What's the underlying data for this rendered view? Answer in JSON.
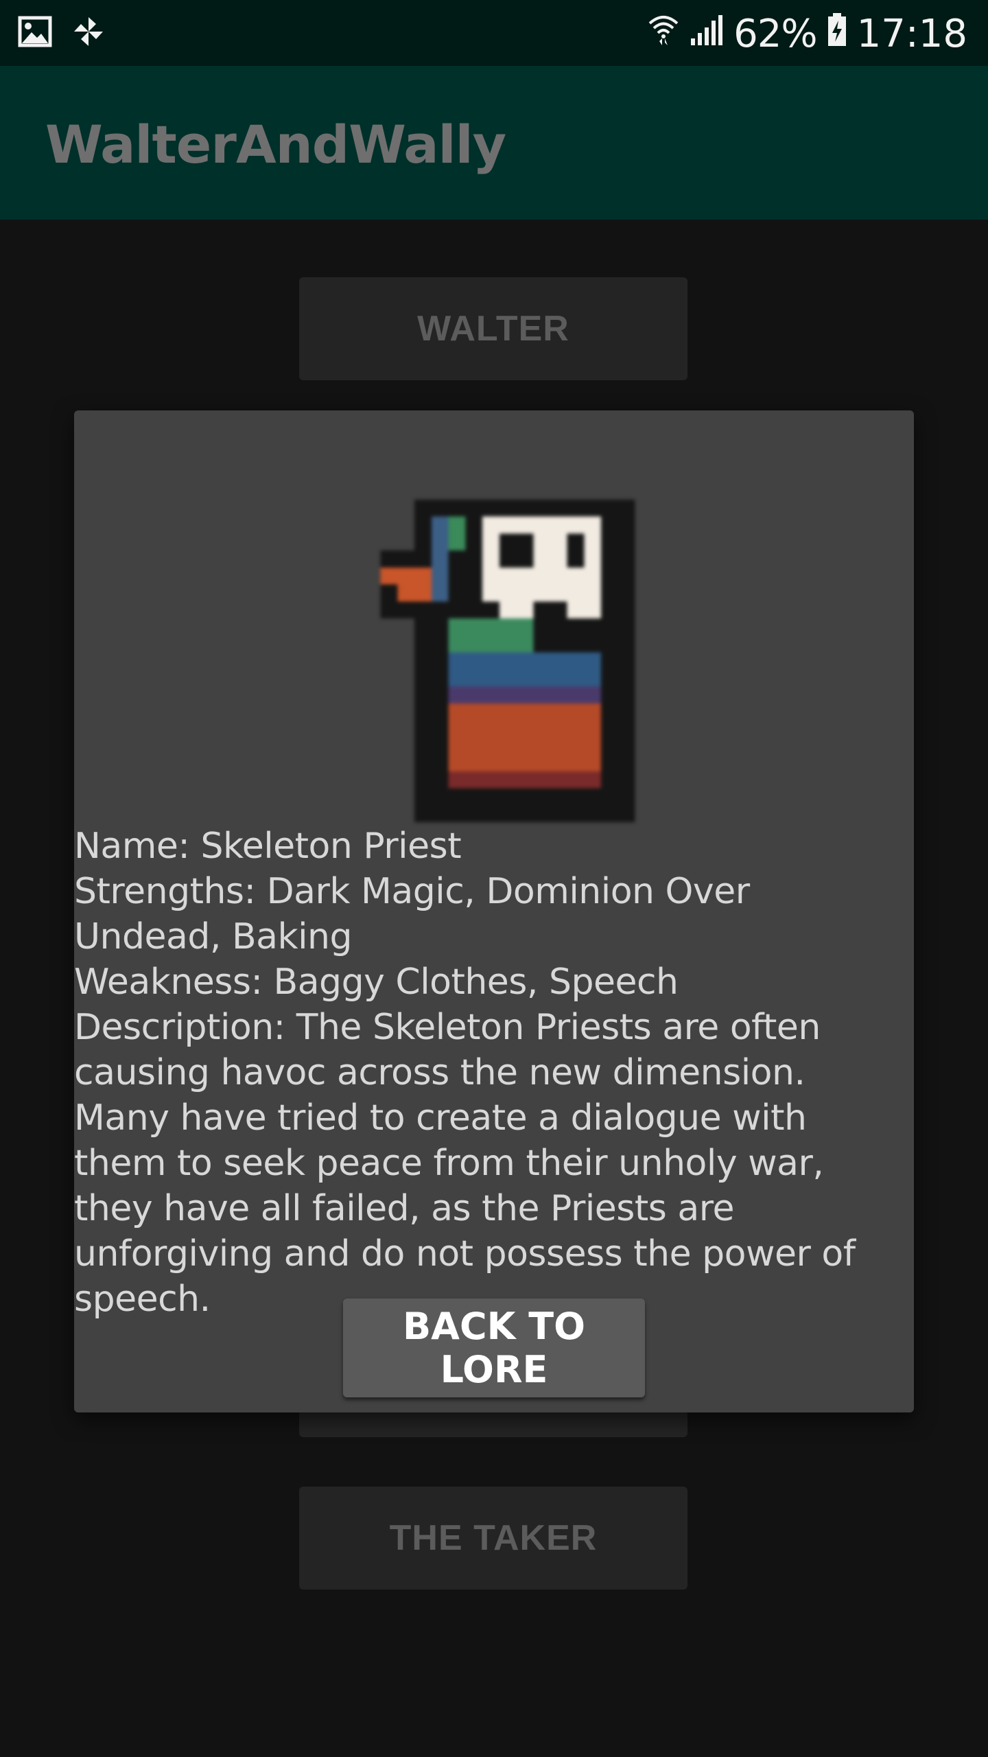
{
  "status_bar": {
    "icons_left": [
      "gallery-icon",
      "pinwheel-icon"
    ],
    "icons_right": [
      "wifi-icon",
      "signal-icon",
      "battery-icon"
    ],
    "battery": "62%",
    "time": "17:18"
  },
  "app_bar": {
    "title": "WalterAndWally"
  },
  "background_buttons": {
    "walter": "WALTER",
    "taker": "THE TAKER"
  },
  "dialog": {
    "name": "Name: Skeleton Priest",
    "strengths": " Strengths: Dark Magic, Dominion Over Undead, Baking",
    "weakness": " Weakness: Baggy Clothes, Speech",
    "description": " Description: The Skeleton Priests are often causing havoc across the new dimension. Many have tried to create a dialogue with them to seek peace from their unholy war, they have all failed, as the Priests are unforgiving and do not possess the power of speech.",
    "back_button": "BACK TO LORE"
  },
  "colors": {
    "status_bar": "#001a15",
    "app_bar": "#00302a",
    "dialog": "#424242",
    "overlay_bg": "#121212"
  }
}
